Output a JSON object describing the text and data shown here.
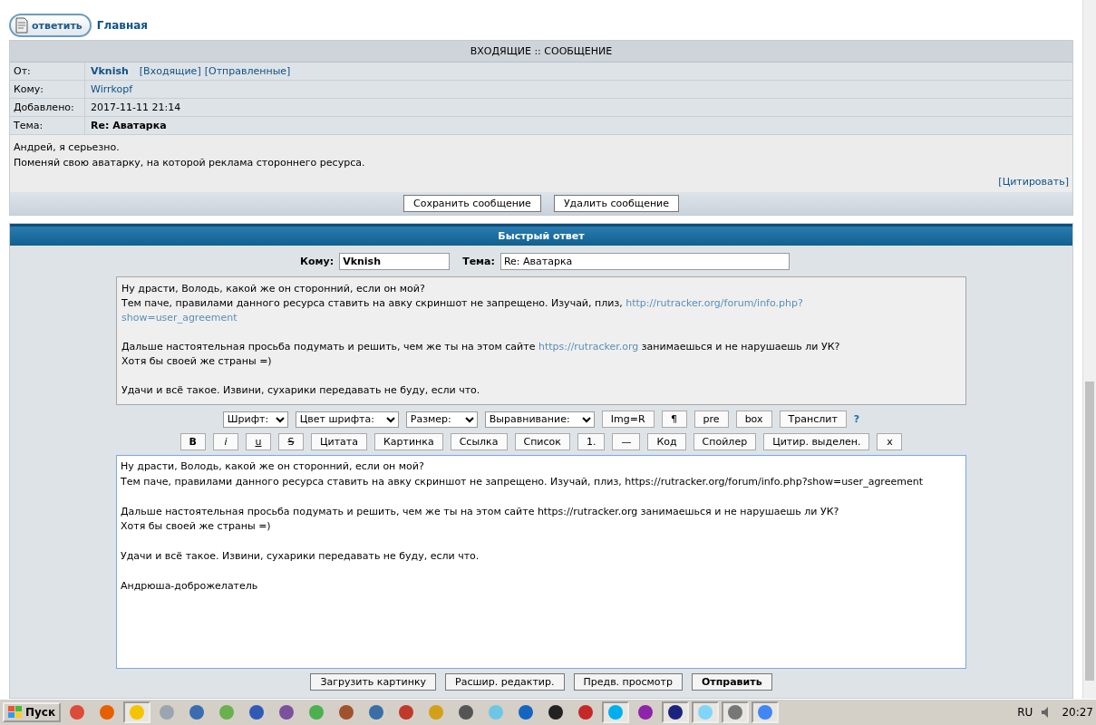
{
  "toolbar": {
    "reply_button": "ответить",
    "home_link": "Главная"
  },
  "message": {
    "header": "ВХОДЯЩИЕ :: СООБЩЕНИЕ",
    "rows": [
      {
        "label": "От:",
        "kind": "user",
        "value": "Vknish",
        "links": [
          "[Входящие]",
          "[Отправленные]"
        ]
      },
      {
        "label": "Кому:",
        "kind": "link",
        "value": "Wirrkopf"
      },
      {
        "label": "Добавлено:",
        "kind": "text",
        "value": "2017-11-11 21:14"
      },
      {
        "label": "Тема:",
        "kind": "bold",
        "value": "Re: Аватарка"
      }
    ],
    "body": [
      "Андрей, я серьезно.",
      "Поменяй свою аватарку, на которой реклама стороннего ресурса."
    ],
    "quote_link": "[Цитировать]",
    "buttons": [
      "Сохранить сообщение",
      "Удалить сообщение"
    ]
  },
  "quick_reply": {
    "title": "Быстрый ответ",
    "to_label": "Кому:",
    "to_value": "Vknish",
    "subject_label": "Тема:",
    "subject_value": "Re: Аватарка",
    "preview": [
      [
        [
          {
            "text": "Ну драсти, Володь, какой же он сторонний, если он мой?",
            "link": false
          }
        ],
        [
          {
            "text": "Тем паче, правилами данного ресурса ставить на авку скриншот не запрещено. Изучай, плиз, ",
            "link": false
          },
          {
            "text": "http://rutracker.org/forum/info.php?",
            "link": true
          }
        ],
        [
          {
            "text": "show=user_agreement",
            "link": true
          }
        ]
      ],
      [
        [
          {
            "text": "Дальше настоятельная просьба подумать и решить, чем же ты на этом сайте ",
            "link": false
          },
          {
            "text": "https://rutracker.org",
            "link": true
          },
          {
            "text": " занимаешься и не нарушаешь ли УК?",
            "link": false
          }
        ],
        [
          {
            "text": "Хотя бы своей же страны =)",
            "link": false
          }
        ]
      ],
      [
        [
          {
            "text": "Удачи и всё такое. Извини, сухарики передавать не буду, если что.",
            "link": false
          }
        ]
      ]
    ],
    "toolbar_row1": [
      {
        "kind": "select",
        "label": "Шрифт:"
      },
      {
        "kind": "select",
        "label": "Цвет шрифта:"
      },
      {
        "kind": "select",
        "label": "Размер:"
      },
      {
        "kind": "select",
        "label": "Выравнивание:"
      },
      {
        "kind": "button",
        "label": "Img=R"
      },
      {
        "kind": "button",
        "label": "¶"
      },
      {
        "kind": "button",
        "label": "pre"
      },
      {
        "kind": "button",
        "label": "box"
      },
      {
        "kind": "button",
        "label": "Транслит"
      },
      {
        "kind": "help",
        "label": "?"
      }
    ],
    "toolbar_row2": [
      {
        "kind": "bold",
        "label": "B"
      },
      {
        "kind": "italic",
        "label": "i"
      },
      {
        "kind": "underline",
        "label": "u"
      },
      {
        "kind": "strike",
        "label": "S"
      },
      {
        "kind": "button",
        "label": "Цитата"
      },
      {
        "kind": "button",
        "label": "Картинка"
      },
      {
        "kind": "button",
        "label": "Ссылка"
      },
      {
        "kind": "button",
        "label": "Список"
      },
      {
        "kind": "button",
        "label": "1."
      },
      {
        "kind": "button",
        "label": "—"
      },
      {
        "kind": "button",
        "label": "Код"
      },
      {
        "kind": "button",
        "label": "Спойлер"
      },
      {
        "kind": "button",
        "label": "Цитир. выделен."
      },
      {
        "kind": "button",
        "label": "x"
      }
    ],
    "editor_value": "Ну драсти, Володь, какой же он сторонний, если он мой?\nТем паче, правилами данного ресурса ставить на авку скриншот не запрещено. Изучай, плиз, https://rutracker.org/forum/info.php?show=user_agreement\n\nДальше настоятельная просьба подумать и решить, чем же ты на этом сайте https://rutracker.org занимаешься и не нарушаешь ли УК?\nХотя бы своей же страны =)\n\nУдачи и всё такое. Извини, сухарики передавать не буду, если что.\n\nАндрюша-доброжелатель",
    "buttons": [
      {
        "label": "Загрузить картинку",
        "primary": false
      },
      {
        "label": "Расшир. редактир.",
        "primary": false
      },
      {
        "label": "Предв. просмотр",
        "primary": false
      },
      {
        "label": "Отправить",
        "primary": true
      }
    ]
  },
  "taskbar": {
    "start": "Пуск",
    "apps": [
      {
        "color": "#dd4b39",
        "active": false
      },
      {
        "color": "#e66000",
        "active": false
      },
      {
        "color": "#f5c400",
        "active": true
      },
      {
        "color": "#9aa5b1",
        "active": false
      },
      {
        "color": "#3b6cb0",
        "active": false
      },
      {
        "color": "#6ab04c",
        "active": false
      },
      {
        "color": "#2f5bb7",
        "active": false
      },
      {
        "color": "#7b519d",
        "active": false
      },
      {
        "color": "#4caf50",
        "active": false
      },
      {
        "color": "#a0522d",
        "active": false
      },
      {
        "color": "#3a6ea5",
        "active": false
      },
      {
        "color": "#c0392b",
        "active": false
      },
      {
        "color": "#d4a017",
        "active": false
      },
      {
        "color": "#555555",
        "active": false
      },
      {
        "color": "#6ec6e6",
        "active": false
      },
      {
        "color": "#1565c0",
        "active": false
      },
      {
        "color": "#222222",
        "active": false
      },
      {
        "color": "#c62828",
        "active": false
      },
      {
        "color": "#00aff0",
        "active": true
      },
      {
        "color": "#8e24aa",
        "active": false
      },
      {
        "color": "#1a237e",
        "active": true
      },
      {
        "color": "#81d4fa",
        "active": true
      },
      {
        "color": "#777777",
        "active": true
      },
      {
        "color": "#4285f4",
        "active": true
      }
    ],
    "language": "RU",
    "clock": "20:27"
  }
}
